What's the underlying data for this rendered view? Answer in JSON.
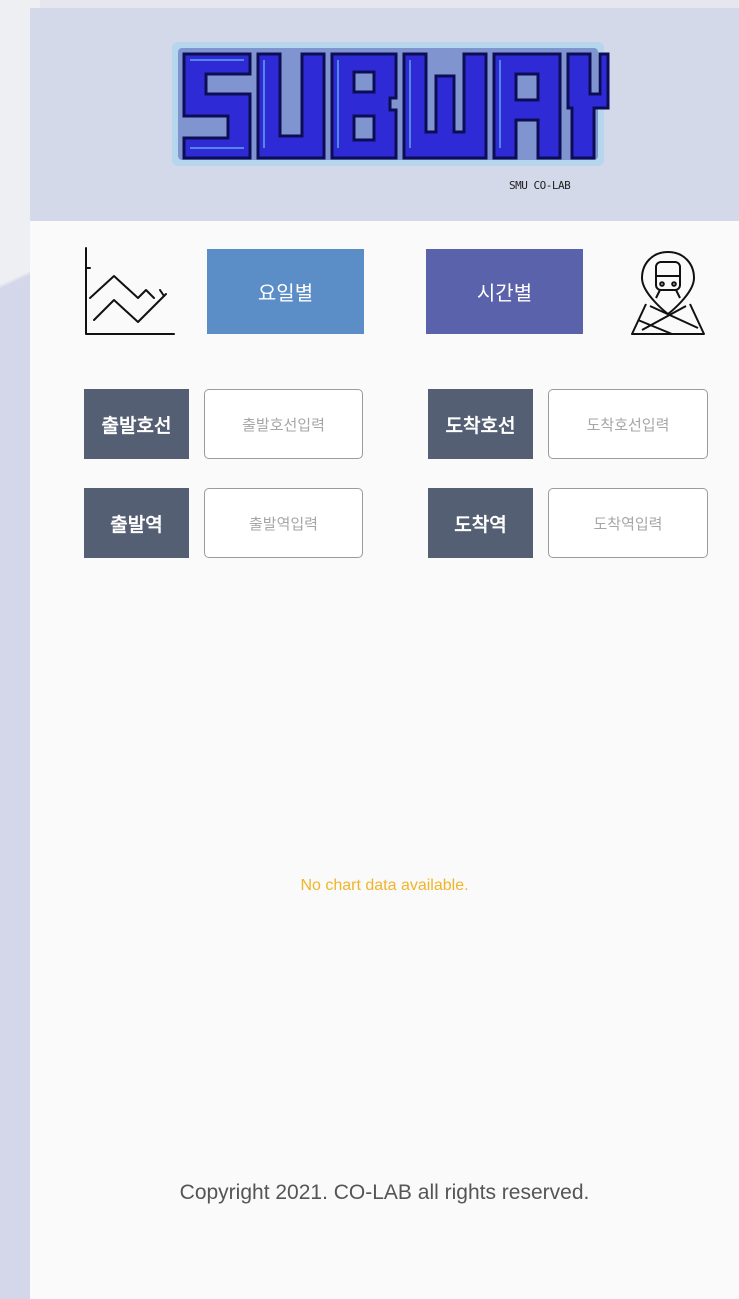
{
  "header": {
    "logo_text": "SUBWAY",
    "logo_subtitle": "SMU CO-LAB"
  },
  "mode_buttons": {
    "by_day": "요일별",
    "by_time": "시간별"
  },
  "icons": {
    "chart": "line-chart-icon",
    "map": "map-pin-train-icon"
  },
  "form": {
    "departure_line_label": "출발호선",
    "departure_line_placeholder": "출발호선입력",
    "arrival_line_label": "도착호선",
    "arrival_line_placeholder": "도착호선입력",
    "departure_station_label": "출발역",
    "departure_station_placeholder": "출발역입력",
    "arrival_station_label": "도착역",
    "arrival_station_placeholder": "도착역입력"
  },
  "chart": {
    "empty_message": "No chart data available."
  },
  "footer": {
    "copyright": "Copyright 2021. CO-LAB all rights reserved."
  },
  "colors": {
    "header_bg": "#d3d9e8",
    "by_day_button": "#5b8dc7",
    "by_time_button": "#5a62ab",
    "label_bg": "#545f73",
    "empty_message": "#f0b429",
    "logo_fill": "#2e2bd6"
  }
}
